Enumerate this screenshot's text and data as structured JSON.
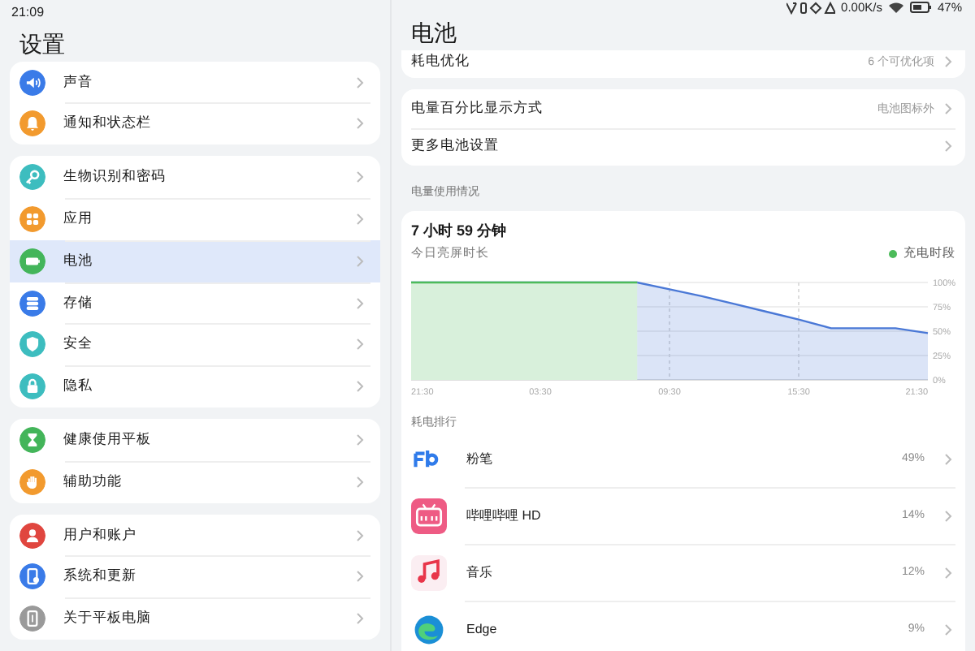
{
  "status_bar": {
    "time": "21:09",
    "network_speed": "0.00K/s",
    "battery": "47%"
  },
  "sidebar": {
    "title": "设置",
    "groups": [
      {
        "items": [
          {
            "label": "声音",
            "kind": "sound",
            "color": "#3a7be8",
            "selected": false
          },
          {
            "label": "通知和状态栏",
            "kind": "bell",
            "color": "#f29a2e",
            "selected": false
          }
        ]
      },
      {
        "items": [
          {
            "label": "生物识别和密码",
            "kind": "key",
            "color": "#3dbdbf",
            "selected": false
          },
          {
            "label": "应用",
            "kind": "grid",
            "color": "#f29a2e",
            "selected": false
          },
          {
            "label": "电池",
            "kind": "battery",
            "color": "#43b55a",
            "selected": true
          },
          {
            "label": "存储",
            "kind": "stack",
            "color": "#3a7be8",
            "selected": false
          },
          {
            "label": "安全",
            "kind": "shield",
            "color": "#3dbdbf",
            "selected": false
          },
          {
            "label": "隐私",
            "kind": "lock",
            "color": "#3dbdbf",
            "selected": false
          }
        ]
      },
      {
        "items": [
          {
            "label": "健康使用平板",
            "kind": "hourglass",
            "color": "#43b55a",
            "selected": false
          },
          {
            "label": "辅助功能",
            "kind": "hand",
            "color": "#f29a2e",
            "selected": false
          }
        ]
      },
      {
        "items": [
          {
            "label": "用户和账户",
            "kind": "person",
            "color": "#e0463f",
            "selected": false
          },
          {
            "label": "系统和更新",
            "kind": "phone",
            "color": "#3a7be8",
            "selected": false
          },
          {
            "label": "关于平板电脑",
            "kind": "tablet",
            "color": "#9a9a9a",
            "selected": false
          }
        ]
      }
    ]
  },
  "detail": {
    "title": "电池",
    "groups": [
      {
        "rows": [
          {
            "label": "耗电优化",
            "value": "6 个可优化项"
          }
        ]
      },
      {
        "rows": [
          {
            "label": "电量百分比显示方式",
            "value": "电池图标外"
          },
          {
            "label": "更多电池设置"
          }
        ]
      }
    ],
    "usage_section": {
      "label": "电量使用情况",
      "screen_time": "7 小时 59 分钟",
      "screen_time_label": "今日亮屏时长",
      "chart_data": {
        "type": "area",
        "categories": [
          "21:30",
          null,
          null,
          null,
          "03:30",
          null,
          null,
          null,
          "09:30",
          null,
          null,
          null,
          "15:30",
          null,
          null,
          null,
          "21:30"
        ],
        "series": [
          {
            "color": "#4a78d6",
            "values": [
              100,
              100,
              100,
              100,
              100,
              100,
              100,
              100,
              93,
              86,
              78,
              70,
              62,
              53,
              53,
              53,
              48
            ]
          },
          {
            "name": "充电时段",
            "color": "#4cbb5a",
            "values": [
              100,
              100,
              100,
              100,
              100,
              100,
              100,
              100,
              null,
              null,
              null,
              null,
              null,
              null,
              null,
              null,
              null
            ]
          }
        ],
        "ylim": [
          0,
          100
        ],
        "grid": true,
        "yticks": [
          {
            "value": 100,
            "label": "100%"
          },
          {
            "value": 75,
            "label": "75%"
          },
          {
            "value": 50,
            "label": "50%"
          },
          {
            "value": 25,
            "label": "25%"
          },
          {
            "value": 0,
            "label": "0%"
          }
        ]
      }
    },
    "ranking": {
      "label": "耗电排行",
      "apps": [
        {
          "name": "粉笔",
          "kind": "letters",
          "share": "49%"
        },
        {
          "name": "哔哩哔哩 HD",
          "kind": "tv",
          "share": "14%"
        },
        {
          "name": "音乐",
          "kind": "note",
          "share": "12%"
        },
        {
          "name": "Edge",
          "kind": "wave",
          "share": "9%"
        }
      ]
    }
  }
}
